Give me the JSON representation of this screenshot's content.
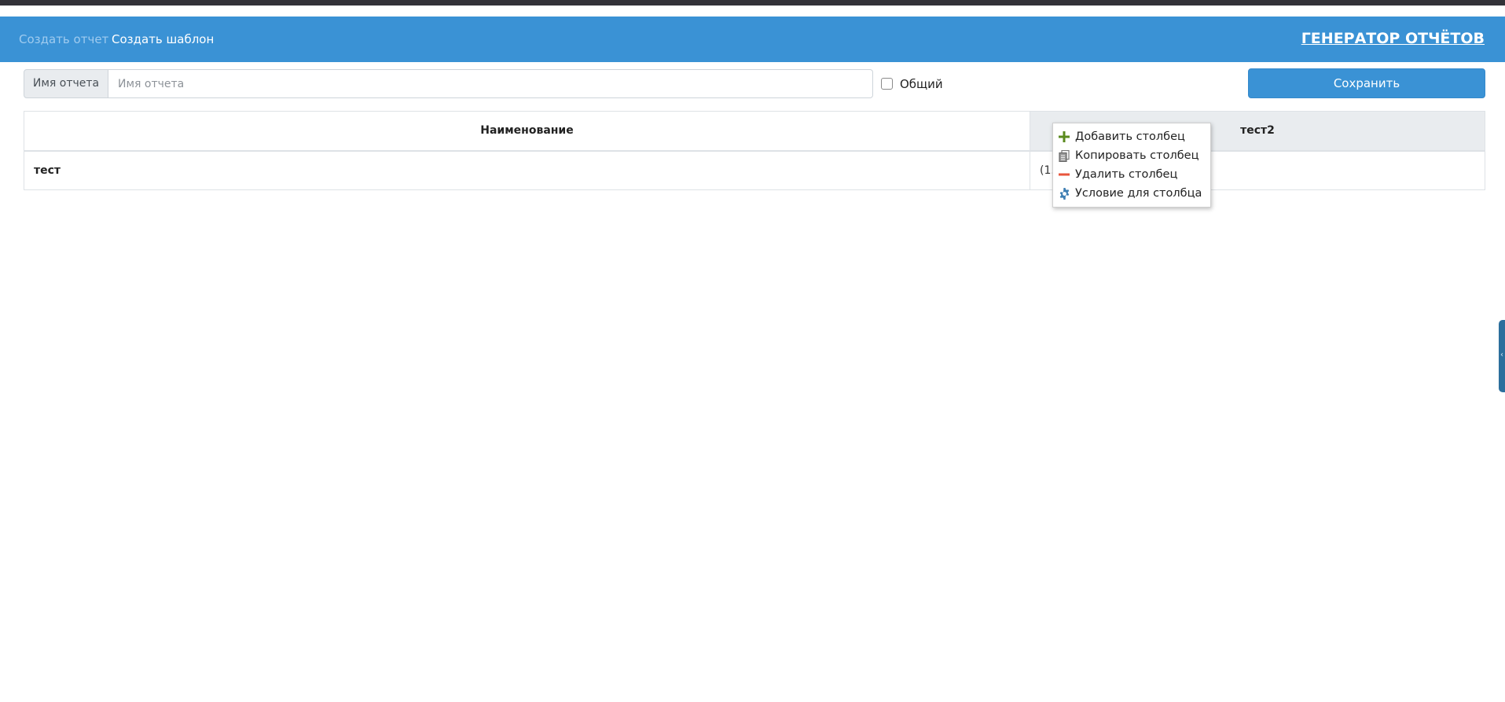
{
  "navbar": {
    "links": [
      {
        "label": "Создать отчет",
        "state": "muted"
      },
      {
        "label": "Создать шаблон",
        "state": "active"
      }
    ],
    "brand": "ГЕНЕРАТОР ОТЧЁТОВ"
  },
  "form": {
    "report_name_label": "Имя отчета",
    "report_name_placeholder": "Имя отчета",
    "report_name_value": "",
    "common_label": "Общий",
    "common_checked": false,
    "save_label": "Сохранить"
  },
  "table": {
    "columns": [
      "Наименование",
      "тест2"
    ],
    "rows": [
      {
        "name": "тест",
        "value": "(1."
      }
    ]
  },
  "context_menu": {
    "items": [
      {
        "label": "Добавить столбец",
        "icon": "plus-icon"
      },
      {
        "label": "Копировать столбец",
        "icon": "copy-icon"
      },
      {
        "label": "Удалить столбец",
        "icon": "minus-icon"
      },
      {
        "label": "Условие для столбца",
        "icon": "gear-icon"
      }
    ]
  },
  "colors": {
    "accent": "#3a92d5",
    "plus": "#5a8a1e",
    "minus": "#e8553c",
    "gear": "#3f7fb3"
  }
}
